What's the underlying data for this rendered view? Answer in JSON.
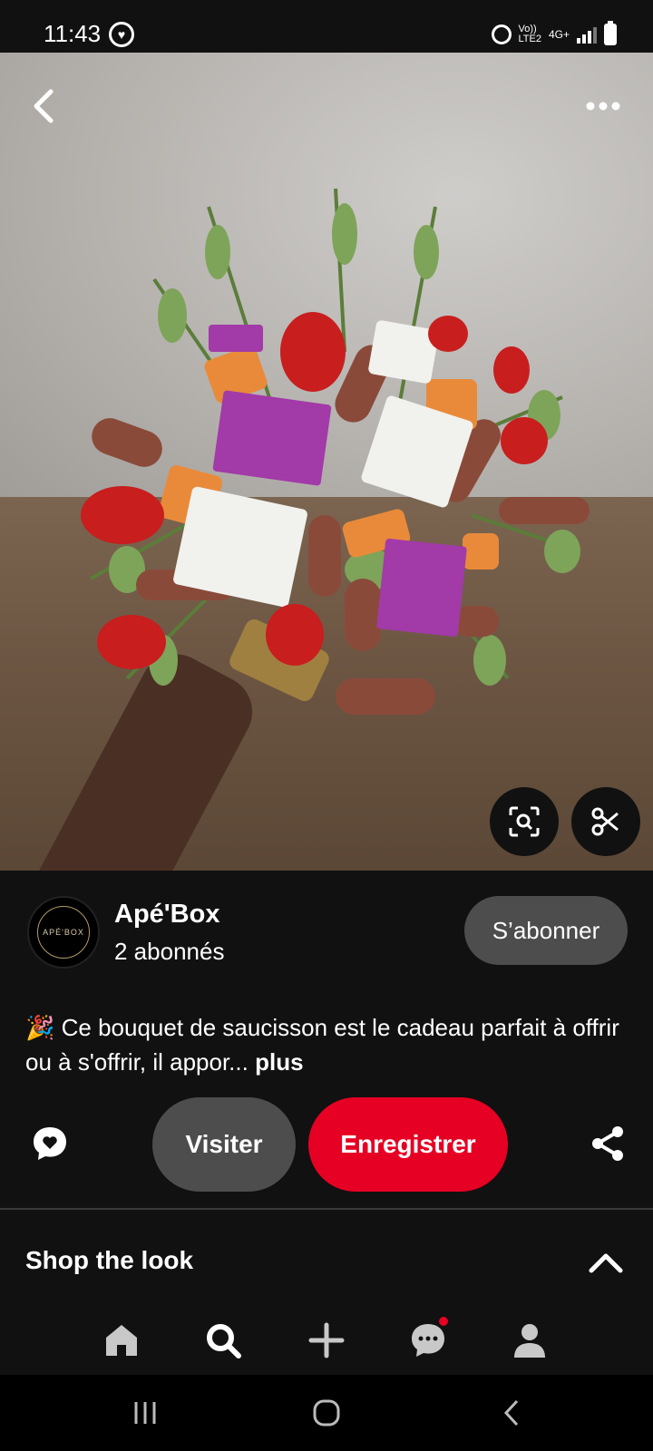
{
  "status_bar": {
    "time": "11:43",
    "network_top": "Vo))",
    "network_bottom": "LTE2",
    "network_type": "4G+",
    "icons": [
      "heart-circle-icon",
      "alarm-icon",
      "signal-icon",
      "battery-icon"
    ]
  },
  "image": {
    "description_icon_names": [
      "back-arrow-icon",
      "more-dots-icon",
      "visual-search-icon",
      "scissors-icon"
    ]
  },
  "creator": {
    "name": "Apé'Box",
    "followers": "2 abonnés",
    "avatar_text": "APÉ'BOX",
    "subscribe_label": "S’abonner"
  },
  "description": {
    "emoji": "🎉",
    "text": "Ce bouquet de saucisson est le cadeau parfait à offrir ou à s'offrir, il appor...",
    "more_label": "plus"
  },
  "actions": {
    "visit_label": "Visiter",
    "save_label": "Enregistrer"
  },
  "shop": {
    "title": "Shop the look"
  },
  "bottom_nav": {
    "items": [
      "home-icon",
      "search-icon",
      "plus-icon",
      "messages-icon",
      "profile-icon"
    ],
    "notification_color": "#e60023"
  },
  "colors": {
    "accent": "#e60023",
    "button_gray": "#4d4d4d",
    "background": "#111111"
  }
}
